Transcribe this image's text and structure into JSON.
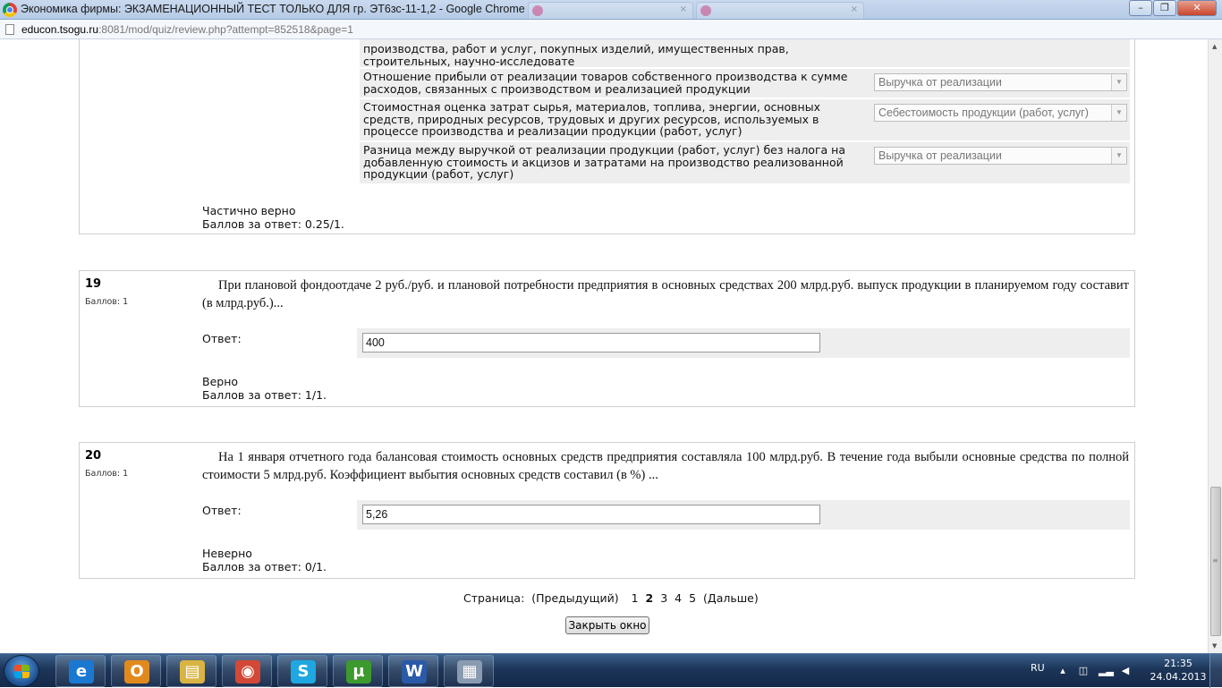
{
  "browser": {
    "window_title": "Экономика фирмы: ЭКЗАМЕНАЦИОННЫЙ ТЕСТ ТОЛЬКО ДЛЯ гр. ЭТ6зс-11-1,2 - Google Chrome",
    "url_host": "educon.tsogu.ru",
    "url_rest": ":8081/mod/quiz/review.php?attempt=852518&page=1",
    "window_buttons": {
      "minimize": "–",
      "restore": "❐",
      "close": "✕"
    }
  },
  "question18": {
    "partial_text": "производства, работ и услуг, покупных изделий, имущественных прав, строительных, научно-исследовате",
    "rows": [
      {
        "text": "Отношение прибыли от реализации товаров собственного производства к сумме расходов, связанных с производством и реализацией продукции",
        "selected": "Выручка от реализации"
      },
      {
        "text": "Стоимостная оценка затрат сырья, материалов, топлива, энергии, основных средств, природных ресурсов, трудовых и других ресурсов, используемых в процессе производства и реализации продукции (работ, услуг)",
        "selected": "Себестоимость продукции (работ, услуг)"
      },
      {
        "text": "Разница между выручкой от реализации продукции (работ, услуг) без налога на добавленную стоимость и акцизов и затратами на производство реализованной продукции (работ, услуг)",
        "selected": "Выручка от реализации"
      }
    ],
    "result": "Частично верно",
    "score": "Баллов за ответ: 0.25/1."
  },
  "question19": {
    "number": "19",
    "grade": "Баллов: 1",
    "text": "При плановой  фондоотдаче 2 руб./руб. и плановой потребности предприятия в основных средствах 200 млрд.руб. выпуск продукции  в планируемом году составит (в млрд.руб.)...",
    "answer_label": "Ответ:",
    "answer": "400",
    "result": "Верно",
    "score": "Баллов за ответ: 1/1."
  },
  "question20": {
    "number": "20",
    "grade": "Баллов: 1",
    "text": "На 1 января отчетного года балансовая стоимость основных средств предприятия составляла 100 млрд.руб. В течение года выбыли основные средства по полной стоимости 5 млрд.руб. Коэффициент выбытия основных средств составил  (в %) ...",
    "answer_label": "Ответ:",
    "answer": "5,26",
    "result": "Неверно",
    "score": "Баллов за ответ: 0/1."
  },
  "paging": {
    "label": "Страница:",
    "prev": "(Предыдущий)",
    "pages": [
      "1",
      "2",
      "3",
      "4",
      "5"
    ],
    "current": "2",
    "next": "(Дальше)"
  },
  "close_button": "Закрыть окно",
  "taskbar": {
    "language": "RU",
    "time": "21:35",
    "date": "24.04.2013",
    "apps": [
      {
        "name": "internet-explorer",
        "glyph": "e",
        "color": "#1b78d0"
      },
      {
        "name": "outlook",
        "glyph": "O",
        "color": "#e08a1e"
      },
      {
        "name": "file-explorer",
        "glyph": "▤",
        "color": "#d9b443"
      },
      {
        "name": "chrome",
        "glyph": "◉",
        "color": "#d34836"
      },
      {
        "name": "skype",
        "glyph": "S",
        "color": "#1ea7e0"
      },
      {
        "name": "utorrent",
        "glyph": "µ",
        "color": "#3d9a2e"
      },
      {
        "name": "word",
        "glyph": "W",
        "color": "#2a5aa8"
      },
      {
        "name": "calculator",
        "glyph": "▦",
        "color": "#8a9bb0"
      }
    ]
  }
}
